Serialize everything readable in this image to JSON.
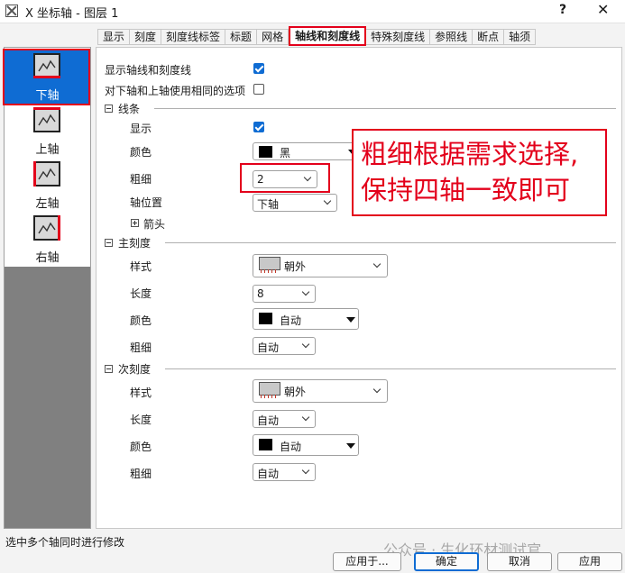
{
  "window": {
    "title": "X 坐标轴 - 图层 1",
    "help": "?",
    "close": "✕"
  },
  "tabs": [
    {
      "label": "显示"
    },
    {
      "label": "刻度"
    },
    {
      "label": "刻度线标签"
    },
    {
      "label": "标题"
    },
    {
      "label": "网格"
    },
    {
      "label": "轴线和刻度线",
      "active": true
    },
    {
      "label": "特殊刻度线"
    },
    {
      "label": "参照线"
    },
    {
      "label": "断点"
    },
    {
      "label": "轴须"
    }
  ],
  "axes": [
    {
      "label": "下轴",
      "selected": true
    },
    {
      "label": "上轴"
    },
    {
      "label": "左轴"
    },
    {
      "label": "右轴"
    }
  ],
  "options": {
    "show_axes_ticks": {
      "label": "显示轴线和刻度线",
      "checked": true
    },
    "same_options": {
      "label": "对下轴和上轴使用相同的选项",
      "checked": false
    }
  },
  "line_section": {
    "title": "线条",
    "show": {
      "label": "显示",
      "checked": true
    },
    "color": {
      "label": "颜色",
      "value": "黑",
      "swatch": "#000000"
    },
    "thickness": {
      "label": "粗细",
      "value": "2"
    },
    "position": {
      "label": "轴位置",
      "value": "下轴"
    },
    "arrow": {
      "label": "箭头"
    }
  },
  "major_section": {
    "title": "主刻度",
    "style": {
      "label": "样式",
      "value": "朝外"
    },
    "length": {
      "label": "长度",
      "value": "8"
    },
    "color": {
      "label": "颜色",
      "value": "自动",
      "swatch": "#000000"
    },
    "thickness": {
      "label": "粗细",
      "value": "自动"
    }
  },
  "minor_section": {
    "title": "次刻度",
    "style": {
      "label": "样式",
      "value": "朝外"
    },
    "length": {
      "label": "长度",
      "value": "自动"
    },
    "color": {
      "label": "颜色",
      "value": "自动",
      "swatch": "#000000"
    },
    "thickness": {
      "label": "粗细",
      "value": "自动"
    }
  },
  "annotation": {
    "line1": "粗细根据需求选择,",
    "line2": "保持四轴一致即可",
    "color": "#e3001b"
  },
  "status": "选中多个轴同时进行修改",
  "buttons": {
    "apply_to": "应用于...",
    "ok": "确定",
    "cancel": "取消",
    "apply": "应用"
  },
  "watermark": "公众号 · 生化环材测试官"
}
